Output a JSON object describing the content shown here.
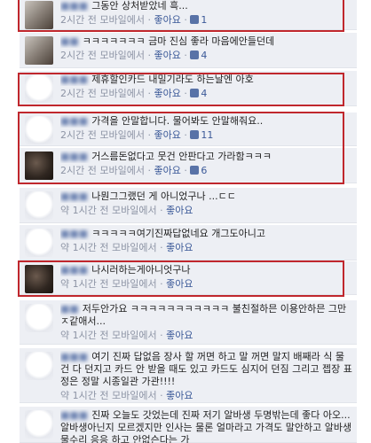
{
  "comments": [
    {
      "text": "그동안 상처받았네 흑...",
      "time": "2시간 전 모바일에서",
      "like": "좋아요",
      "likes": "1"
    },
    {
      "text": "ㅋㅋㅋㅋㅋㅋㅋ 금마 진심 좋라 마음에안들던데",
      "time": "2시간 전 모바일에서",
      "like": "좋아요",
      "likes": "4"
    },
    {
      "text": "제휴할인카드 내밀기라도 하는날엔 아호",
      "time": "2시간 전 모바일에서",
      "like": "좋아요",
      "likes": "4"
    },
    {
      "text": "가격을 안말합니다. 물어봐도 안말해줘요..",
      "time": "2시간 전 모바일에서",
      "like": "좋아요",
      "likes": "11"
    },
    {
      "text": "거스름돈없다고 뭇건 안판다고 가라함ㅋㅋㅋ",
      "time": "2시간 전 모바일에서",
      "like": "좋아요",
      "likes": "6"
    },
    {
      "text": "나뭔그그랬던 게 아니었구나 ...ㄷㄷ",
      "time": "약 1시간 전 모바일에서",
      "like": "좋아요",
      "likes": ""
    },
    {
      "text": "ㅋㅋㅋㅋㅋ여기진짜답없네요 개그도아니고",
      "time": "약 1시간 전 모바일에서",
      "like": "좋아요",
      "likes": ""
    },
    {
      "text": "나시러하는게아니엇구나",
      "time": "약 1시간 전 모바일에서",
      "like": "좋아요",
      "likes": ""
    },
    {
      "text": "저두안가요 ㅋㅋㅋㅋㅋㅋㅋㅋㅋㅋㅋ 불친절하믄 이용안하믄 그만 ㅈ같애서...",
      "time": "약 1시간 전 모바일에서",
      "like": "좋아요",
      "likes": ""
    },
    {
      "text": "여기 진짜 답없음 장사 할 꺼면 하고 말 꺼면 말지 배째라 식 물건 다 던지고 카드 안 받을 때도 있고 카드도 심지어 던짐 그리고 젭장 표정은 정말 시종일관 가관!!!!",
      "time": "약 1시간 전 모바일에서",
      "like": "좋아요",
      "likes": ""
    },
    {
      "text": "진짜 오늘도 갓었는데 진짜 저기 알바생 두명밖는데 좋다 아오... 알바생아닌지 모르겠지만 인사는 물론 얼마라고 가격도 말안하고 알바생 물수리 응응 하고 안없슨다는 가",
      "time": "약 1시간 전 모바일에서",
      "like": "좋아요",
      "likes": ""
    }
  ]
}
